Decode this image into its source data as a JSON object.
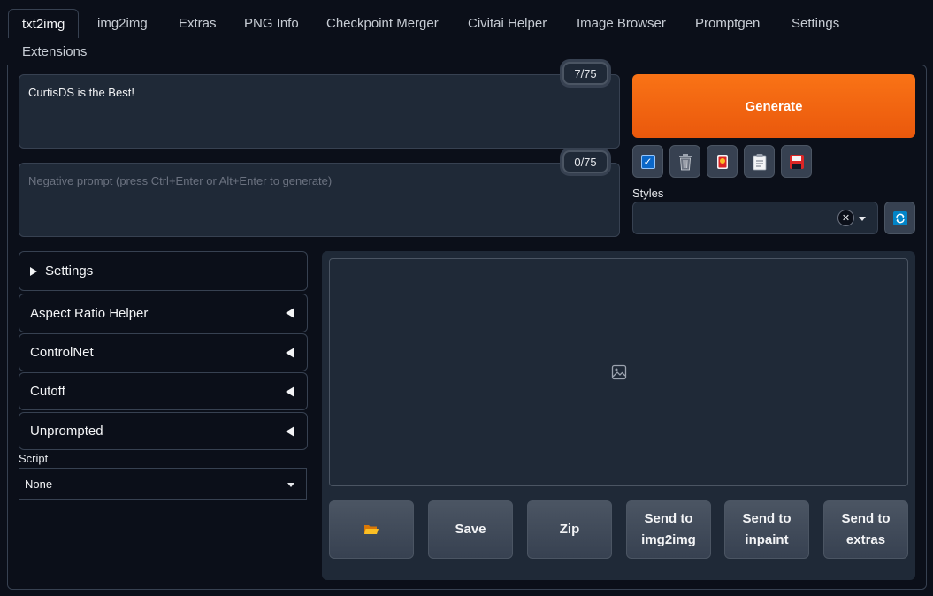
{
  "tabs": [
    {
      "label": "txt2img"
    },
    {
      "label": "img2img"
    },
    {
      "label": "Extras"
    },
    {
      "label": "PNG Info"
    },
    {
      "label": "Checkpoint Merger"
    },
    {
      "label": "Civitai Helper"
    },
    {
      "label": "Image Browser"
    },
    {
      "label": "Promptgen"
    },
    {
      "label": "Settings"
    },
    {
      "label": "Extensions"
    }
  ],
  "prompt": {
    "value": "CurtisDS is the Best!",
    "token_count": "7/75"
  },
  "negative_prompt": {
    "value": "",
    "placeholder": "Negative prompt (press Ctrl+Enter or Alt+Enter to generate)",
    "token_count": "0/75"
  },
  "generate": {
    "label": "Generate"
  },
  "tool_buttons": {
    "icons": [
      "checkbox-icon",
      "trash-icon",
      "red-card-icon",
      "clipboard-icon",
      "floppy-disk-icon"
    ],
    "glyphs": [
      "☑",
      "🗑",
      "🎴",
      "📋",
      "💾"
    ]
  },
  "styles": {
    "label": "Styles",
    "selected": "",
    "refresh_glyph": "🔄"
  },
  "accordions": [
    {
      "label": "Settings",
      "open": true
    },
    {
      "label": "Aspect Ratio Helper",
      "open": false
    },
    {
      "label": "ControlNet",
      "open": false
    },
    {
      "label": "Cutoff",
      "open": false
    },
    {
      "label": "Unprompted",
      "open": false
    }
  ],
  "script": {
    "label": "Script",
    "selected": "None"
  },
  "gallery": {
    "icon": "image-placeholder-icon"
  },
  "actions": [
    {
      "label": "📂",
      "icon": "folder-icon"
    },
    {
      "label": "Save"
    },
    {
      "label": "Zip"
    },
    {
      "label": "Send to\nimg2img"
    },
    {
      "label": "Send to\ninpaint"
    },
    {
      "label": "Send to\nextras"
    }
  ],
  "colors": {
    "background": "#0b0f19",
    "panel": "#1f2937",
    "border": "#374151",
    "generate_start": "#f97316",
    "generate_end": "#ea580c"
  }
}
